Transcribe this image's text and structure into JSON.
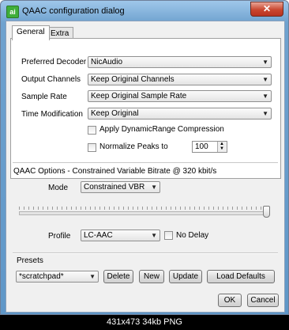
{
  "window": {
    "title": "QAAC configuration dialog",
    "icon": "app-icon",
    "close_glyph": "✕",
    "app_glyph": "ai"
  },
  "tabs": [
    {
      "label": "General",
      "active": true
    },
    {
      "label": "Extra",
      "active": false
    }
  ],
  "general": {
    "preferred_decoder": {
      "label": "Preferred Decoder",
      "value": "NicAudio"
    },
    "output_channels": {
      "label": "Output Channels",
      "value": "Keep Original Channels"
    },
    "sample_rate": {
      "label": "Sample Rate",
      "value": "Keep Original Sample Rate"
    },
    "time_modification": {
      "label": "Time Modification",
      "value": "Keep Original"
    },
    "apply_drc": {
      "label": "Apply DynamicRange Compression",
      "checked": false
    },
    "normalize_peaks": {
      "label": "Normalize Peaks to",
      "checked": false,
      "value": "100"
    }
  },
  "qaac_options": {
    "heading": "QAAC Options - Constrained Variable Bitrate @ 320 kbit/s",
    "mode": {
      "label": "Mode",
      "value": "Constrained VBR"
    },
    "bitrate_slider": {
      "fraction": 1.0
    },
    "profile": {
      "label": "Profile",
      "value": "LC-AAC"
    },
    "no_delay": {
      "label": "No Delay",
      "checked": false
    }
  },
  "presets": {
    "heading": "Presets",
    "selected": "*scratchpad*",
    "delete_label": "Delete",
    "new_label": "New",
    "update_label": "Update",
    "load_defaults_label": "Load Defaults"
  },
  "footer": {
    "ok_label": "OK",
    "cancel_label": "Cancel"
  },
  "caption": "431x473 34kb PNG",
  "colors": {
    "title_bar": "#6fa2cf",
    "close_button": "#c9472f",
    "dialog_bg": "#f0f0f0"
  }
}
